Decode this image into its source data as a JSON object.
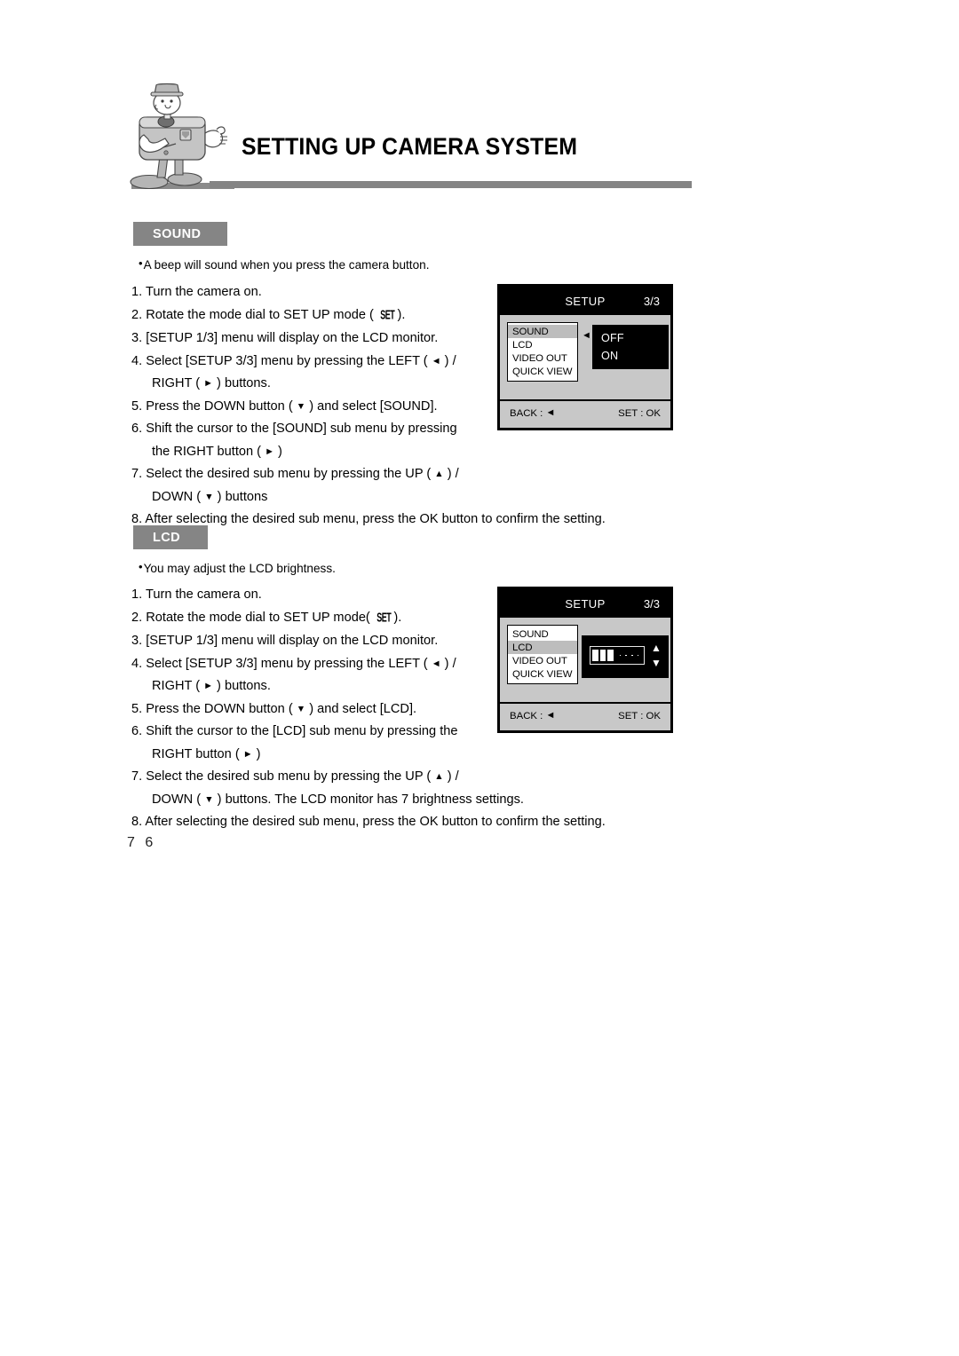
{
  "header": {
    "title": "SETTING UP CAMERA SYSTEM",
    "mascot_icon": "camera-mascot-illustration"
  },
  "page_number": "7 6",
  "sections": [
    {
      "chip_label": "SOUND",
      "bullet": "A beep will sound when you press the camera button.",
      "steps": [
        {
          "num": "1.",
          "text": "Turn the camera on."
        },
        {
          "num": "2.",
          "pre": "Rotate the mode dial to SET UP mode ( ",
          "icon": "SET",
          "post": ")."
        },
        {
          "num": "3.",
          "text": "[SETUP 1/3] menu will display on the LCD monitor."
        },
        {
          "num": "4.",
          "pre": "Select [SETUP 3/3] menu by pressing the LEFT ( ",
          "glyph": "◄",
          "post": " ) /",
          "cont_pre": "RIGHT ( ",
          "cont_glyph": "►",
          "cont_post": " ) buttons."
        },
        {
          "num": "5.",
          "pre": "Press the DOWN button ( ",
          "glyph": "▼",
          "post": " ) and select [SOUND]."
        },
        {
          "num": "6.",
          "text": "Shift the cursor to the [SOUND] sub menu by pressing",
          "cont_pre": "the RIGHT button ( ",
          "cont_glyph": "►",
          "cont_post": " )"
        },
        {
          "num": "7.",
          "pre": "Select the desired sub menu by pressing the UP ( ",
          "glyph": "▲",
          "post": " ) /",
          "cont_pre": "DOWN ( ",
          "cont_glyph": "▼",
          "cont_post": " ) buttons"
        },
        {
          "num": "8.",
          "text": "After selecting the desired sub menu, press the OK button to confirm the setting."
        }
      ]
    },
    {
      "chip_label": "LCD",
      "bullet": "You may adjust the LCD brightness.",
      "steps": [
        {
          "num": "1.",
          "text": "Turn the camera on."
        },
        {
          "num": "2.",
          "pre": "Rotate the mode dial to SET UP mode( ",
          "icon": "SET",
          "post": ")."
        },
        {
          "num": "3.",
          "text": "[SETUP 1/3]  menu will display on the LCD monitor."
        },
        {
          "num": "4.",
          "pre": "Select [SETUP 3/3] menu by pressing the LEFT ( ",
          "glyph": "◄",
          "post": " ) /",
          "cont_pre": "RIGHT ( ",
          "cont_glyph": "►",
          "cont_post": " ) buttons."
        },
        {
          "num": "5.",
          "pre": "Press the DOWN button ( ",
          "glyph": "▼",
          "post": " ) and select [LCD]."
        },
        {
          "num": "6.",
          "text": "Shift the cursor to the [LCD] sub menu by pressing the",
          "cont_pre": "RIGHT button ( ",
          "cont_glyph": "►",
          "cont_post": " )"
        },
        {
          "num": "7.",
          "pre": "Select the desired sub menu by pressing the UP ( ",
          "glyph": "▲",
          "post": " ) /",
          "cont_pre": "DOWN ( ",
          "cont_glyph": "▼",
          "cont_post": " ) buttons. The LCD monitor has 7 brightness settings."
        },
        {
          "num": "8.",
          "text": "After selecting the desired sub menu, press the OK button to confirm the setting."
        }
      ]
    }
  ],
  "screens": {
    "sound": {
      "title": "SETUP",
      "page_indicator": "3/3",
      "menu_items": [
        "SOUND",
        "LCD",
        "VIDEO OUT",
        "QUICK VIEW"
      ],
      "selected_menu": "SOUND",
      "cursor_glyph": "◄",
      "submenu_options": [
        "OFF",
        "ON"
      ],
      "back_label": "BACK :",
      "back_glyph": "◄",
      "set_label": "SET : OK"
    },
    "lcd": {
      "title": "SETUP",
      "page_indicator": "3/3",
      "menu_items": [
        "SOUND",
        "LCD",
        "VIDEO OUT",
        "QUICK VIEW"
      ],
      "selected_menu": "LCD",
      "cursor_glyph": "◄",
      "brightness_filled": 3,
      "brightness_total": 7,
      "up_glyph": "▲",
      "down_glyph": "▼",
      "back_label": "BACK :",
      "back_glyph": "◄",
      "set_label": "SET : OK"
    }
  },
  "colors": {
    "chip_background": "#858585",
    "rule": "#848484",
    "screen_body": "#c8c8c8",
    "screen_bar": "#000000",
    "menu_highlight": "#bdbdbd"
  }
}
